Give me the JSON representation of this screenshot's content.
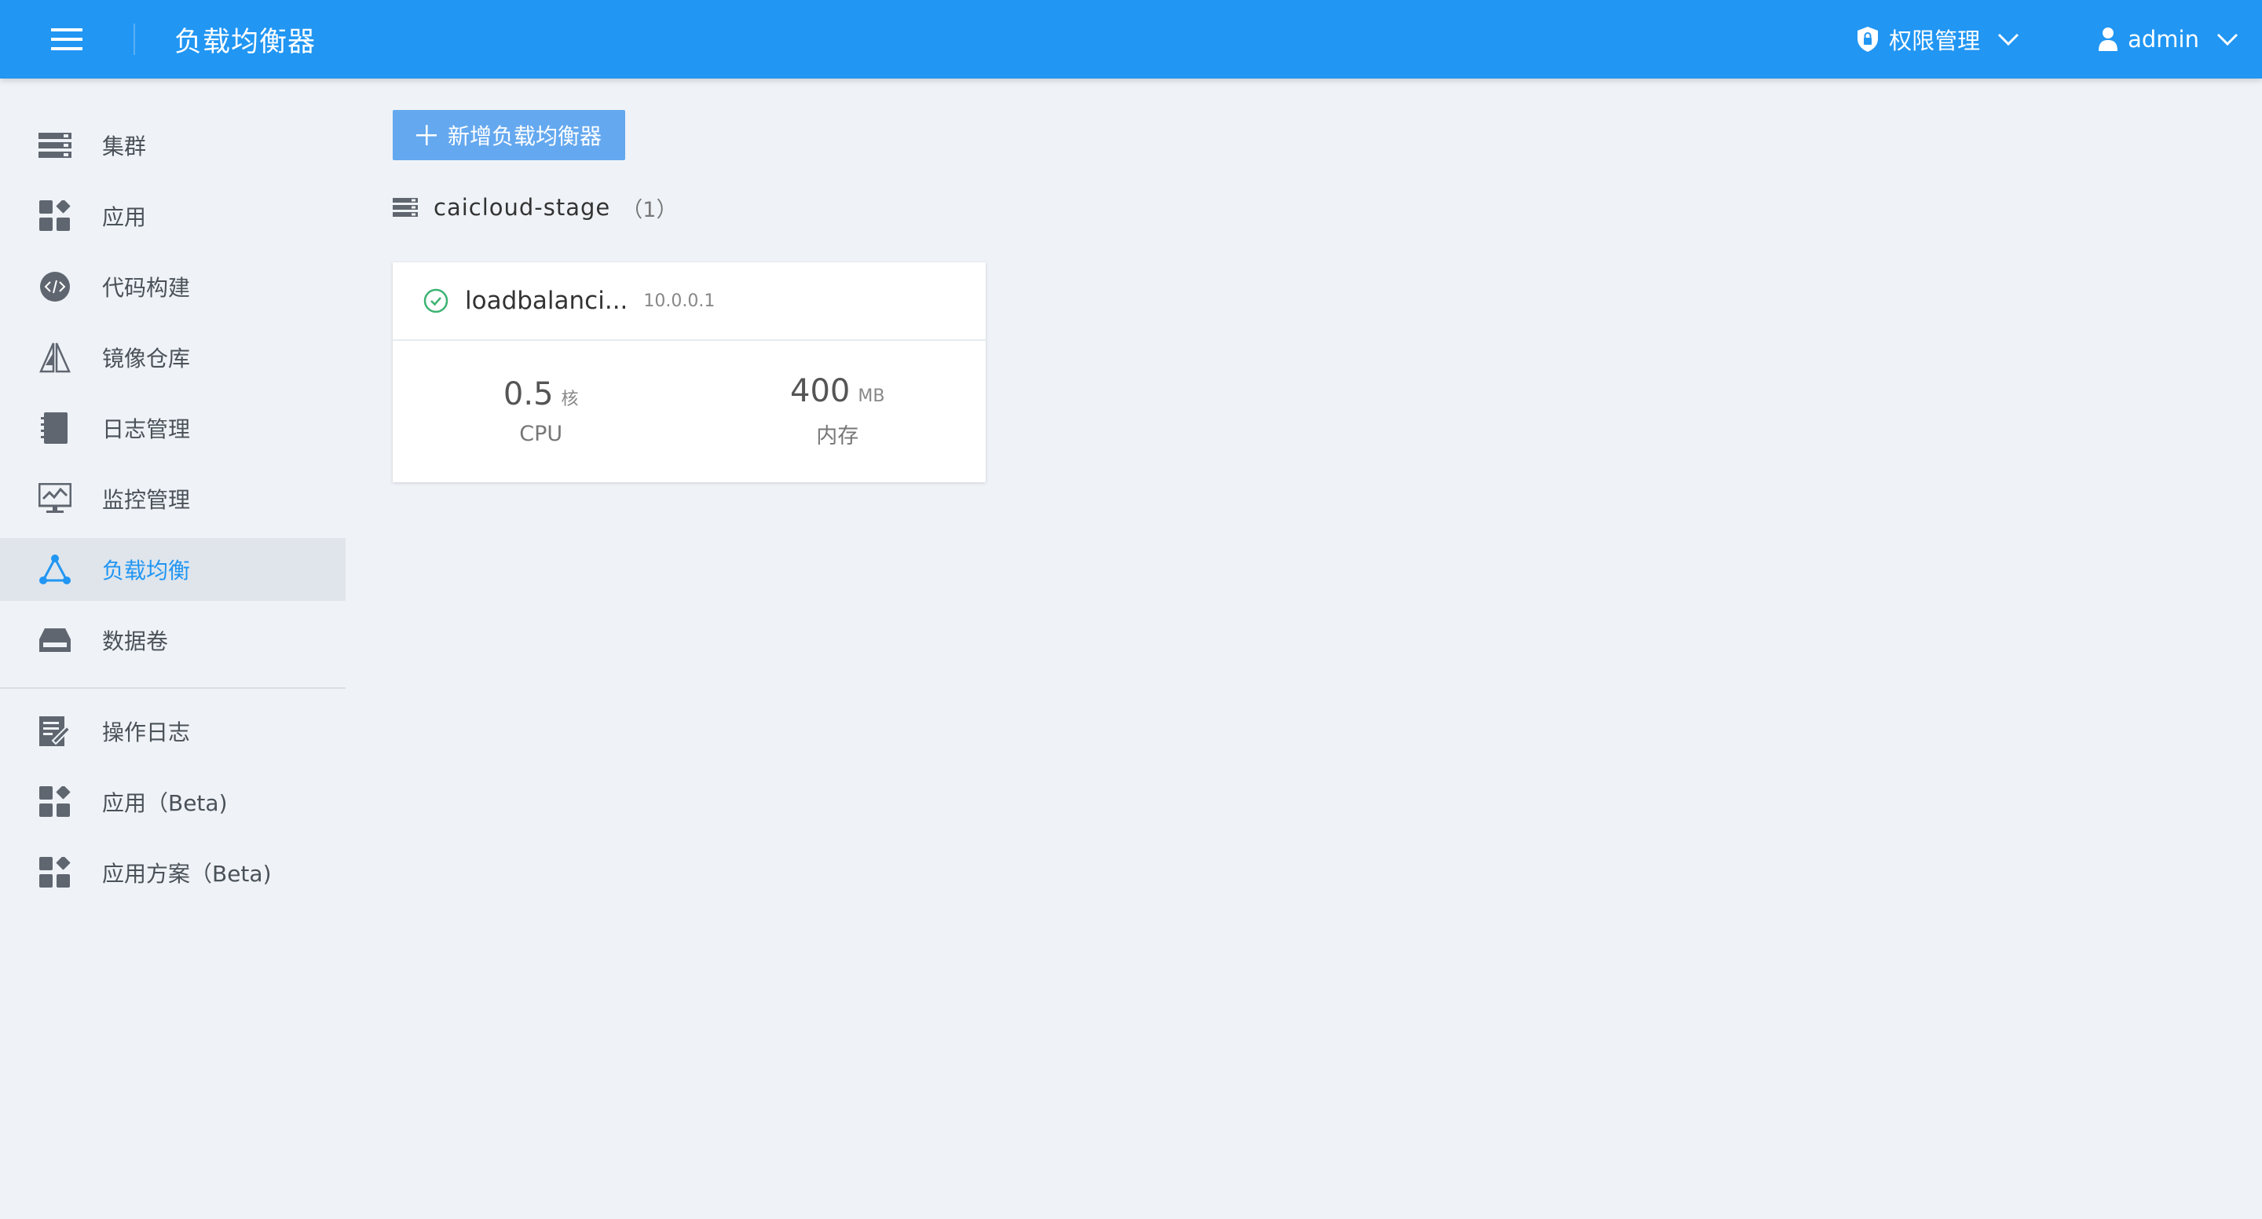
{
  "header": {
    "title": "负载均衡器",
    "permission_label": "权限管理",
    "user_label": "admin"
  },
  "sidebar": {
    "items": [
      {
        "label": "集群",
        "icon": "server-icon"
      },
      {
        "label": "应用",
        "icon": "apps-icon"
      },
      {
        "label": "代码构建",
        "icon": "code-icon"
      },
      {
        "label": "镜像仓库",
        "icon": "image-repo-icon"
      },
      {
        "label": "日志管理",
        "icon": "log-icon"
      },
      {
        "label": "监控管理",
        "icon": "monitor-icon"
      },
      {
        "label": "负载均衡",
        "icon": "load-balance-icon",
        "active": true
      },
      {
        "label": "数据卷",
        "icon": "volume-icon"
      }
    ],
    "secondary_items": [
      {
        "label": "操作日志",
        "icon": "operation-log-icon"
      },
      {
        "label": "应用（Beta)",
        "icon": "apps-icon"
      },
      {
        "label": "应用方案（Beta)",
        "icon": "apps-icon"
      }
    ]
  },
  "main": {
    "add_button_label": "新增负载均衡器",
    "cluster": {
      "name": "caicloud-stage",
      "count": "（1）"
    },
    "card": {
      "name": "loadbalanci...",
      "ip": "10.0.0.1",
      "status": "running",
      "cpu_value": "0.5",
      "cpu_unit": "核",
      "cpu_label": "CPU",
      "mem_value": "400",
      "mem_unit": "MB",
      "mem_label": "内存"
    }
  },
  "colors": {
    "header_bg": "#2196f3",
    "active_text": "#2196f3",
    "active_bg": "#dfe5eb",
    "button_bg": "#64a8ef",
    "status_ok": "#3cb371",
    "page_bg": "#eff3f7"
  }
}
